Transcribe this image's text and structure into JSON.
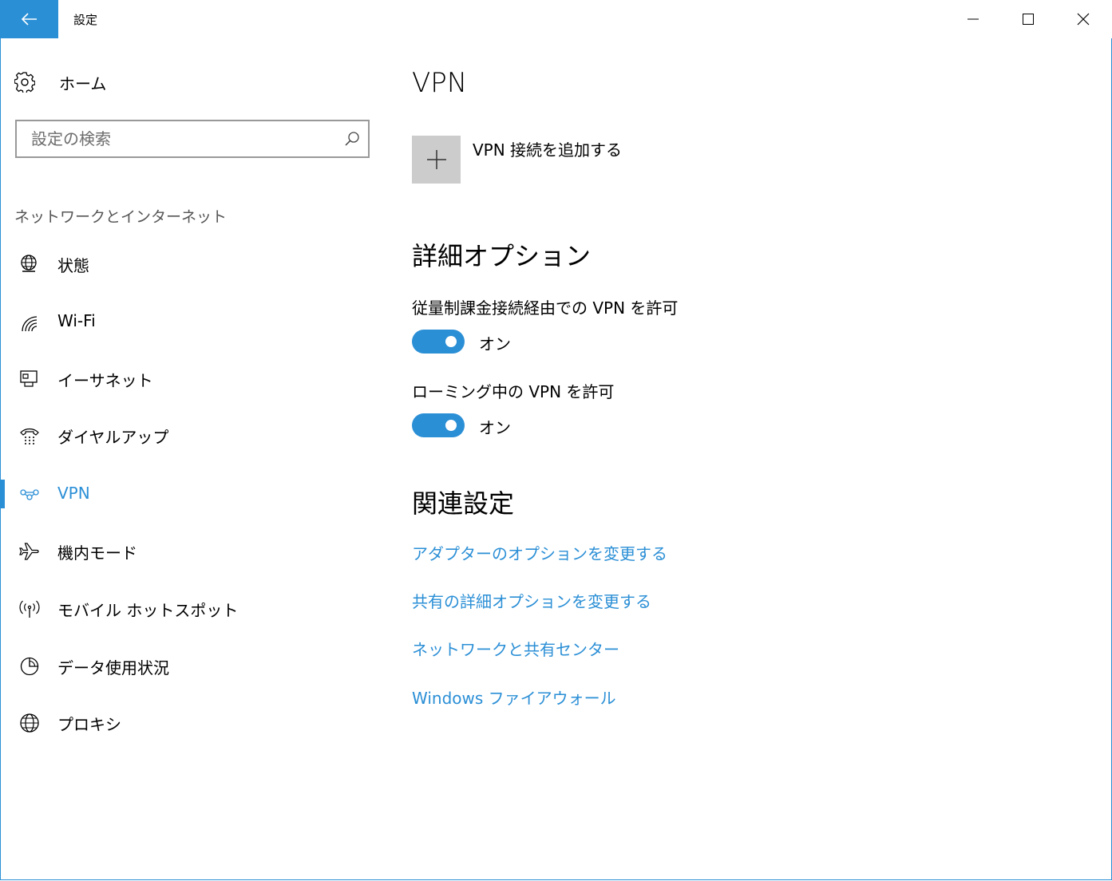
{
  "window": {
    "title": "設定",
    "accent_color": "#2b8fd6",
    "back_icon": "arrow-left-icon",
    "controls": [
      "minimize-icon",
      "maximize-icon",
      "close-icon"
    ]
  },
  "sidebar": {
    "home_label": "ホーム",
    "search_placeholder": "設定の検索",
    "section_label": "ネットワークとインターネット",
    "items": [
      {
        "label": "状態",
        "icon": "globe-status-icon"
      },
      {
        "label": "Wi-Fi",
        "icon": "wifi-icon"
      },
      {
        "label": "イーサネット",
        "icon": "ethernet-icon"
      },
      {
        "label": "ダイヤルアップ",
        "icon": "dialup-icon"
      },
      {
        "label": "VPN",
        "icon": "vpn-icon",
        "selected": true
      },
      {
        "label": "機内モード",
        "icon": "airplane-icon"
      },
      {
        "label": "モバイル ホットスポット",
        "icon": "hotspot-icon"
      },
      {
        "label": "データ使用状況",
        "icon": "pie-chart-icon"
      },
      {
        "label": "プロキシ",
        "icon": "globe-icon"
      }
    ]
  },
  "main": {
    "title": "VPN",
    "add_label": "VPN 接続を追加する",
    "advanced_heading": "詳細オプション",
    "options": [
      {
        "label": "従量制課金接続経由での VPN を許可",
        "state": "オン",
        "on": true
      },
      {
        "label": "ローミング中の VPN を許可",
        "state": "オン",
        "on": true
      }
    ],
    "related_heading": "関連設定",
    "links": [
      "アダプターのオプションを変更する",
      "共有の詳細オプションを変更する",
      "ネットワークと共有センター",
      "Windows ファイアウォール"
    ]
  }
}
